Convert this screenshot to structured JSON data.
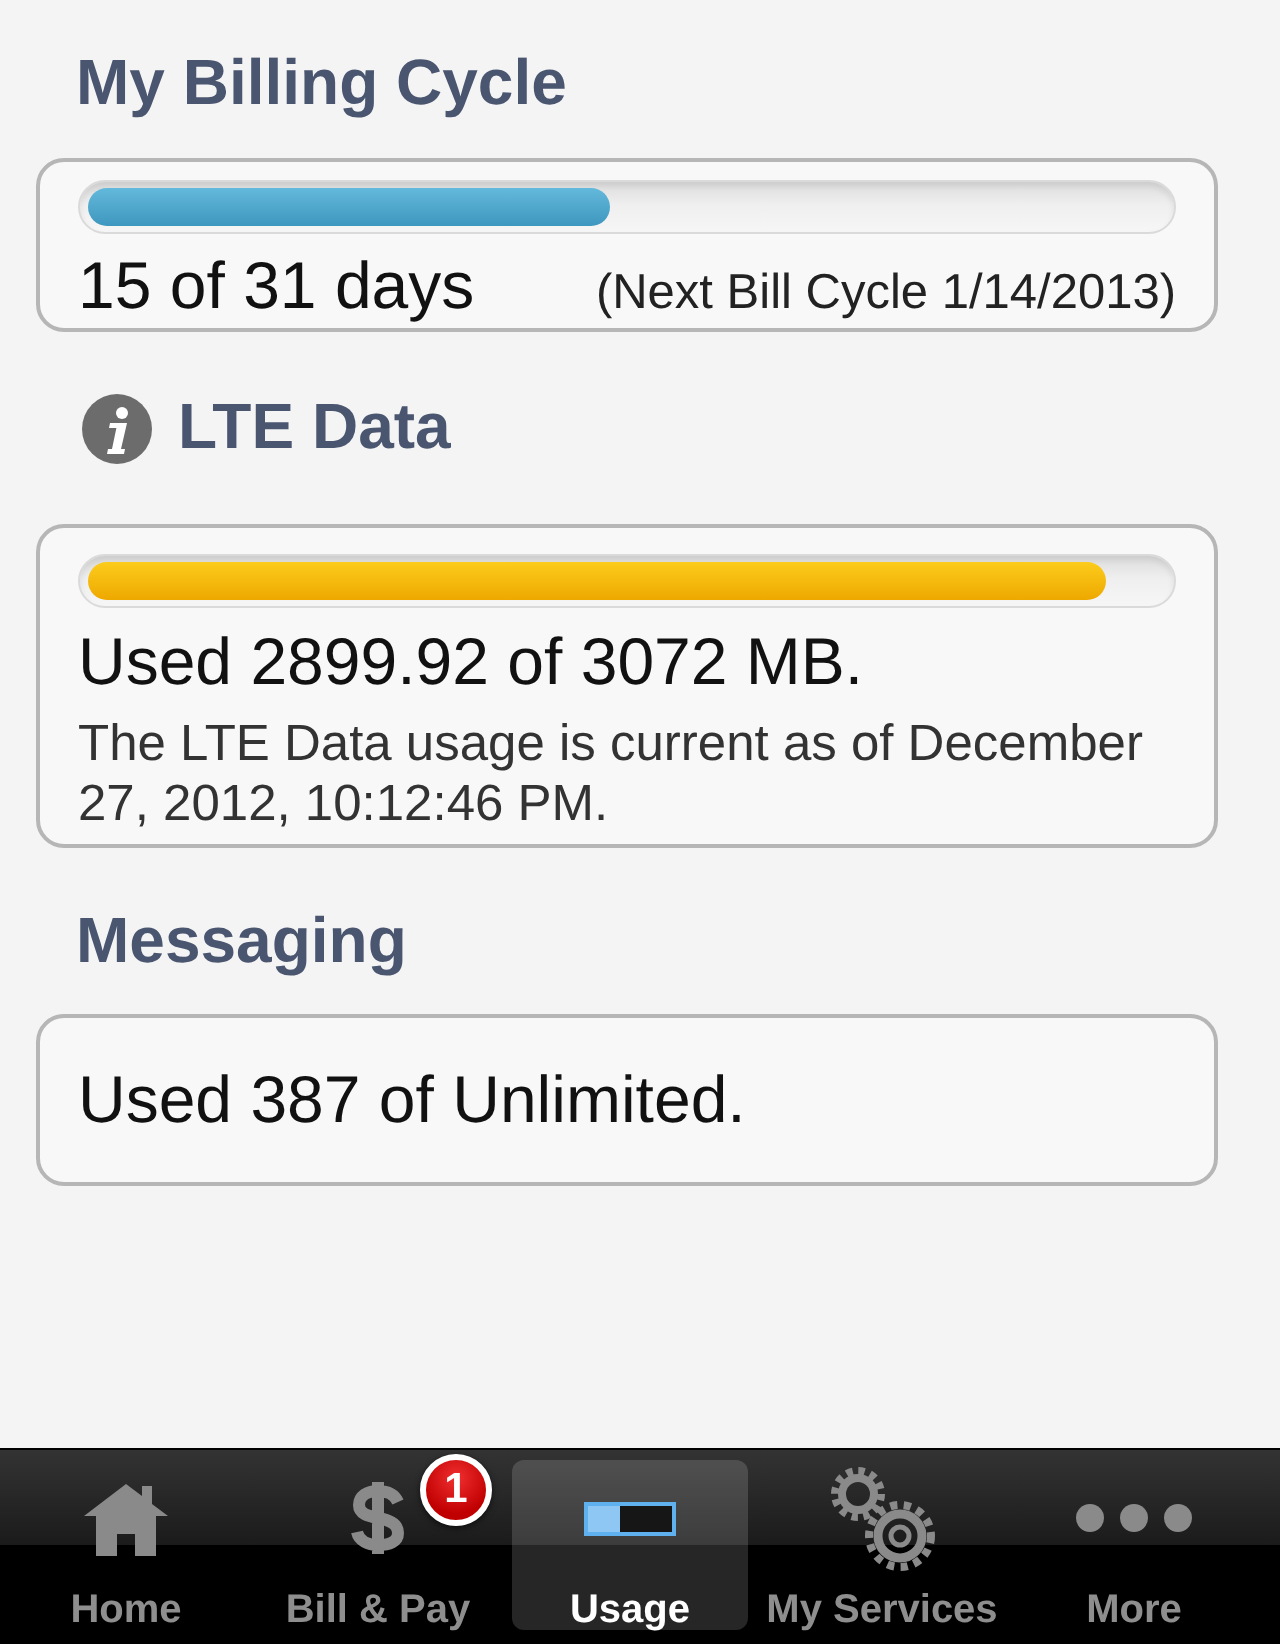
{
  "billing_cycle": {
    "title": "My Billing Cycle",
    "level": 0.484,
    "days": "15 of 31 days",
    "next_cycle": "(Next Bill Cycle 1/14/2013)"
  },
  "lte_data": {
    "title": "LTE Data",
    "level": 0.944,
    "usage": "Used 2899.92 of 3072 MB.",
    "note": "The LTE Data usage is current as of December 27, 2012, 10:12:46 PM."
  },
  "messaging": {
    "title": "Messaging",
    "usage": "Used 387 of Unlimited."
  },
  "tab_bar": [
    {
      "kind": "home",
      "label": "Home",
      "selected": false
    },
    {
      "kind": "bill",
      "label": "Bill & Pay",
      "selected": false,
      "badge": "1"
    },
    {
      "kind": "usage",
      "label": "Usage",
      "selected": true
    },
    {
      "kind": "services",
      "label": "My Services",
      "selected": false
    },
    {
      "kind": "more",
      "label": "More",
      "selected": false
    }
  ]
}
